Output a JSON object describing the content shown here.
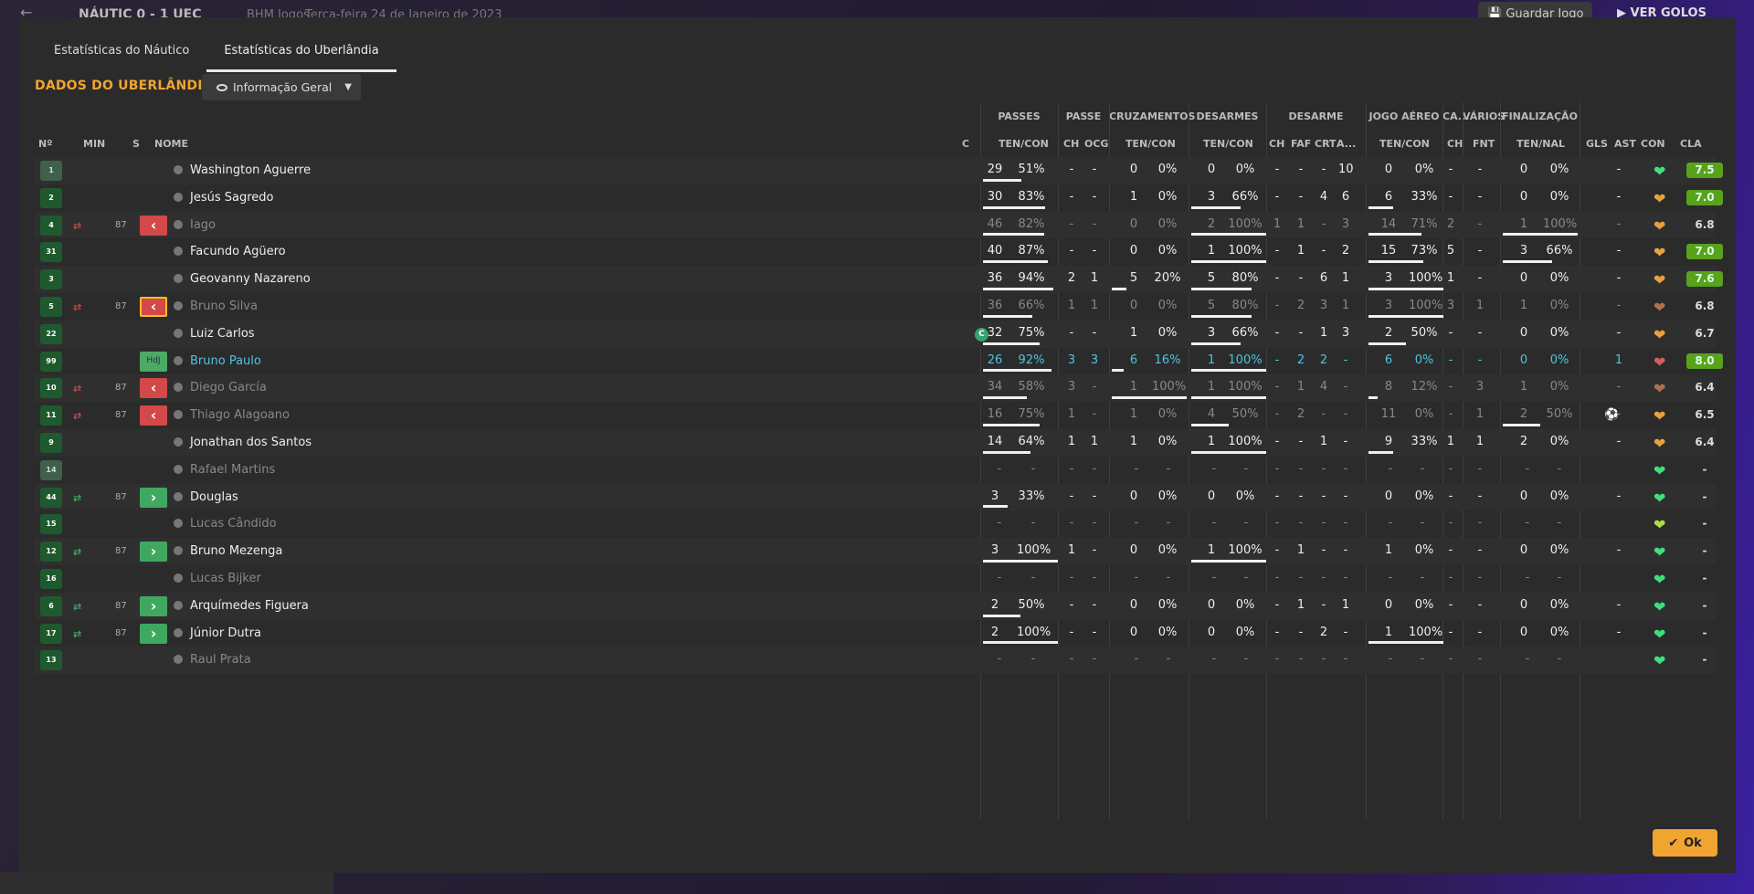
{
  "topbar": {
    "score": "NÁUTIC 0 - 1 UEC",
    "source": "BHM Jogos",
    "date": "Terça-feira 24 de Janeiro de 2023",
    "save_label": "Guardar Jogo",
    "goals_label": "VER GOLOS"
  },
  "tabs": [
    "Estatísticas do Náutico",
    "Estatísticas do Uberlândia"
  ],
  "section_title": "DADOS DO UBERLÂNDIA",
  "view_select": "Informação Geral",
  "groups": [
    "PASSES",
    "PASSE",
    "CRUZAMENTOS",
    "DESARMES",
    "DESARME",
    "JOGO AÉREO",
    "CA...",
    "VÁRIOS",
    "FINALIZAÇÃO"
  ],
  "columns": {
    "no": "Nº",
    "min": "MIN",
    "s": "S",
    "name": "NOME",
    "c": "C",
    "passes": "TEN/CON",
    "passe_ch": "CH",
    "passe_ocg": "OCG",
    "cruz": "TEN/CON",
    "desarmes": "TEN/CON",
    "des_ch": "CH",
    "des_faf": "FAF",
    "des_crt": "CRT",
    "des_a": "A...",
    "aereo": "TEN/CON",
    "ca_ch": "CH",
    "var_fnt": "FNT",
    "fin": "TEN/NAL",
    "gls": "GLS",
    "ast": "AST",
    "con": "CON",
    "cla": "CLA"
  },
  "rows": [
    {
      "no": "1",
      "name": "Washington Aguerre",
      "gk": true,
      "pt": "29",
      "pp": "51%",
      "pb": 51,
      "ch": "-",
      "ocg": "-",
      "ct": "0",
      "cp": "0%",
      "cb": 0,
      "dt": "0",
      "dp": "0%",
      "db": 0,
      "d1": "-",
      "d2": "-",
      "d3": "-",
      "d4": "10",
      "at": "0",
      "ap": "0%",
      "ab": 0,
      "cch": "-",
      "fnt": "-",
      "ft": "0",
      "fp": "0%",
      "fb": 0,
      "gls": "",
      "ast": "-",
      "heart": "green",
      "cla": "7.5",
      "good": true
    },
    {
      "no": "2",
      "name": "Jesús Sagredo",
      "pt": "30",
      "pp": "83%",
      "pb": 83,
      "ch": "-",
      "ocg": "-",
      "ct": "1",
      "cp": "0%",
      "cb": 0,
      "dt": "3",
      "dp": "66%",
      "db": 66,
      "d1": "-",
      "d2": "-",
      "d3": "4",
      "d4": "6",
      "at": "6",
      "ap": "33%",
      "ab": 33,
      "cch": "-",
      "fnt": "-",
      "ft": "0",
      "fp": "0%",
      "fb": 0,
      "gls": "",
      "ast": "-",
      "heart": "orange",
      "cla": "7.0",
      "good": true
    },
    {
      "no": "4",
      "name": "Iago",
      "dim": true,
      "sub": "out",
      "min": "87",
      "pt": "46",
      "pp": "82%",
      "pb": 82,
      "ch": "-",
      "ocg": "-",
      "ct": "0",
      "cp": "0%",
      "cb": 0,
      "dt": "2",
      "dp": "100%",
      "db": 100,
      "d1": "1",
      "d2": "1",
      "d3": "-",
      "d4": "3",
      "at": "14",
      "ap": "71%",
      "ab": 71,
      "cch": "2",
      "fnt": "-",
      "ft": "1",
      "fp": "100%",
      "fb": 100,
      "gls": "",
      "ast": "-",
      "heart": "orange",
      "cla": "6.8"
    },
    {
      "no": "31",
      "name": "Facundo Agüero",
      "pt": "40",
      "pp": "87%",
      "pb": 87,
      "ch": "-",
      "ocg": "-",
      "ct": "0",
      "cp": "0%",
      "cb": 0,
      "dt": "1",
      "dp": "100%",
      "db": 100,
      "d1": "-",
      "d2": "1",
      "d3": "-",
      "d4": "2",
      "at": "15",
      "ap": "73%",
      "ab": 73,
      "cch": "5",
      "fnt": "-",
      "ft": "3",
      "fp": "66%",
      "fb": 66,
      "gls": "",
      "ast": "-",
      "heart": "orange",
      "cla": "7.0",
      "good": true
    },
    {
      "no": "3",
      "name": "Geovanny Nazareno",
      "pt": "36",
      "pp": "94%",
      "pb": 94,
      "ch": "2",
      "ocg": "1",
      "ct": "5",
      "cp": "20%",
      "cb": 20,
      "dt": "5",
      "dp": "80%",
      "db": 80,
      "d1": "-",
      "d2": "-",
      "d3": "6",
      "d4": "1",
      "at": "3",
      "ap": "100%",
      "ab": 100,
      "cch": "1",
      "fnt": "-",
      "ft": "0",
      "fp": "0%",
      "fb": 0,
      "gls": "",
      "ast": "-",
      "heart": "orange",
      "cla": "7.6",
      "good": true
    },
    {
      "no": "5",
      "name": "Bruno Silva",
      "dim": true,
      "sub": "out",
      "yel": true,
      "min": "87",
      "pt": "36",
      "pp": "66%",
      "pb": 66,
      "ch": "1",
      "ocg": "1",
      "ct": "0",
      "cp": "0%",
      "cb": 0,
      "dt": "5",
      "dp": "80%",
      "db": 80,
      "d1": "-",
      "d2": "2",
      "d3": "3",
      "d4": "1",
      "at": "3",
      "ap": "100%",
      "ab": 100,
      "cch": "3",
      "fnt": "1",
      "ft": "1",
      "fp": "0%",
      "fb": 0,
      "gls": "",
      "ast": "-",
      "heart": "brown",
      "cla": "6.8"
    },
    {
      "no": "22",
      "name": "Luiz Carlos",
      "cap": "C",
      "pt": "32",
      "pp": "75%",
      "pb": 75,
      "ch": "-",
      "ocg": "-",
      "ct": "1",
      "cp": "0%",
      "cb": 0,
      "dt": "3",
      "dp": "66%",
      "db": 66,
      "d1": "-",
      "d2": "-",
      "d3": "1",
      "d4": "3",
      "at": "2",
      "ap": "50%",
      "ab": 50,
      "cch": "-",
      "fnt": "-",
      "ft": "0",
      "fp": "0%",
      "fb": 0,
      "gls": "",
      "ast": "-",
      "heart": "orange",
      "cla": "6.7"
    },
    {
      "no": "99",
      "name": "Bruno Paulo",
      "hl": true,
      "sub": "hdj",
      "subtext": "HdJ",
      "pt": "26",
      "pp": "92%",
      "pb": 92,
      "ch": "3",
      "ocg": "3",
      "ct": "6",
      "cp": "16%",
      "cb": 16,
      "dt": "1",
      "dp": "100%",
      "db": 100,
      "d1": "-",
      "d2": "2",
      "d3": "2",
      "d4": "-",
      "at": "6",
      "ap": "0%",
      "ab": 0,
      "cch": "-",
      "fnt": "-",
      "ft": "0",
      "fp": "0%",
      "fb": 0,
      "gls": "",
      "ast": "1",
      "heart": "red",
      "cla": "8.0",
      "good": true
    },
    {
      "no": "10",
      "name": "Diego García",
      "dim": true,
      "sub": "out",
      "min": "87",
      "pt": "34",
      "pp": "58%",
      "pb": 58,
      "ch": "3",
      "ocg": "-",
      "ct": "1",
      "cp": "100%",
      "cb": 100,
      "dt": "1",
      "dp": "100%",
      "db": 100,
      "d1": "-",
      "d2": "1",
      "d3": "4",
      "d4": "-",
      "at": "8",
      "ap": "12%",
      "ab": 12,
      "cch": "-",
      "fnt": "3",
      "ft": "1",
      "fp": "0%",
      "fb": 0,
      "gls": "",
      "ast": "-",
      "heart": "brown",
      "cla": "6.4"
    },
    {
      "no": "11",
      "name": "Thiago Alagoano",
      "dim": true,
      "sub": "out",
      "min": "87",
      "pt": "16",
      "pp": "75%",
      "pb": 75,
      "ch": "1",
      "ocg": "-",
      "ct": "1",
      "cp": "0%",
      "cb": 0,
      "dt": "4",
      "dp": "50%",
      "db": 50,
      "d1": "-",
      "d2": "2",
      "d3": "-",
      "d4": "-",
      "at": "11",
      "ap": "0%",
      "ab": 0,
      "cch": "-",
      "fnt": "1",
      "ft": "2",
      "fp": "50%",
      "fb": 50,
      "gls": "⚽",
      "ast": "-",
      "heart": "orange",
      "cla": "6.5"
    },
    {
      "no": "9",
      "name": "Jonathan dos Santos",
      "pt": "14",
      "pp": "64%",
      "pb": 64,
      "ch": "1",
      "ocg": "1",
      "ct": "1",
      "cp": "0%",
      "cb": 0,
      "dt": "1",
      "dp": "100%",
      "db": 100,
      "d1": "-",
      "d2": "-",
      "d3": "1",
      "d4": "-",
      "at": "9",
      "ap": "33%",
      "ab": 33,
      "cch": "1",
      "fnt": "1",
      "ft": "2",
      "fp": "0%",
      "fb": 0,
      "gls": "",
      "ast": "-",
      "heart": "orange",
      "cla": "6.4"
    },
    {
      "no": "14",
      "name": "Rafael Martins",
      "gk": true,
      "dim": true,
      "empty": true,
      "heart": "green"
    },
    {
      "no": "44",
      "name": "Douglas",
      "sub": "in",
      "min": "87",
      "pt": "3",
      "pp": "33%",
      "pb": 33,
      "ch": "-",
      "ocg": "-",
      "ct": "0",
      "cp": "0%",
      "cb": 0,
      "dt": "0",
      "dp": "0%",
      "db": 0,
      "d1": "-",
      "d2": "-",
      "d3": "-",
      "d4": "-",
      "at": "0",
      "ap": "0%",
      "ab": 0,
      "cch": "-",
      "fnt": "-",
      "ft": "0",
      "fp": "0%",
      "fb": 0,
      "gls": "",
      "ast": "-",
      "heart": "green",
      "cla": "-"
    },
    {
      "no": "15",
      "name": "Lucas Cândido",
      "dim": true,
      "empty": true,
      "heart": "lime"
    },
    {
      "no": "12",
      "name": "Bruno Mezenga",
      "sub": "in",
      "min": "87",
      "pt": "3",
      "pp": "100%",
      "pb": 100,
      "ch": "1",
      "ocg": "-",
      "ct": "0",
      "cp": "0%",
      "cb": 0,
      "dt": "1",
      "dp": "100%",
      "db": 100,
      "d1": "-",
      "d2": "1",
      "d3": "-",
      "d4": "-",
      "at": "1",
      "ap": "0%",
      "ab": 0,
      "cch": "-",
      "fnt": "-",
      "ft": "0",
      "fp": "0%",
      "fb": 0,
      "gls": "",
      "ast": "-",
      "heart": "green",
      "cla": "-"
    },
    {
      "no": "16",
      "name": "Lucas Bijker",
      "dim": true,
      "empty": true,
      "heart": "green"
    },
    {
      "no": "6",
      "name": "Arquímedes Figuera",
      "sub": "in",
      "min": "87",
      "pt": "2",
      "pp": "50%",
      "pb": 50,
      "ch": "-",
      "ocg": "-",
      "ct": "0",
      "cp": "0%",
      "cb": 0,
      "dt": "0",
      "dp": "0%",
      "db": 0,
      "d1": "-",
      "d2": "1",
      "d3": "-",
      "d4": "1",
      "at": "0",
      "ap": "0%",
      "ab": 0,
      "cch": "-",
      "fnt": "-",
      "ft": "0",
      "fp": "0%",
      "fb": 0,
      "gls": "",
      "ast": "-",
      "heart": "green",
      "cla": "-"
    },
    {
      "no": "17",
      "name": "Júnior Dutra",
      "sub": "in",
      "min": "87",
      "pt": "2",
      "pp": "100%",
      "pb": 100,
      "ch": "-",
      "ocg": "-",
      "ct": "0",
      "cp": "0%",
      "cb": 0,
      "dt": "0",
      "dp": "0%",
      "db": 0,
      "d1": "-",
      "d2": "-",
      "d3": "2",
      "d4": "-",
      "at": "1",
      "ap": "100%",
      "ab": 100,
      "cch": "-",
      "fnt": "-",
      "ft": "0",
      "fp": "0%",
      "fb": 0,
      "gls": "",
      "ast": "-",
      "heart": "green",
      "cla": "-"
    },
    {
      "no": "13",
      "name": "Raul Prata",
      "dim": true,
      "empty": true,
      "heart": "green"
    }
  ],
  "ok_label": "Ok",
  "colors": {
    "accent": "#f0a530",
    "good_rating": "#58a21c",
    "sub_out": "#d34848",
    "sub_in": "#3fa860",
    "highlight": "#4fc3e0"
  }
}
